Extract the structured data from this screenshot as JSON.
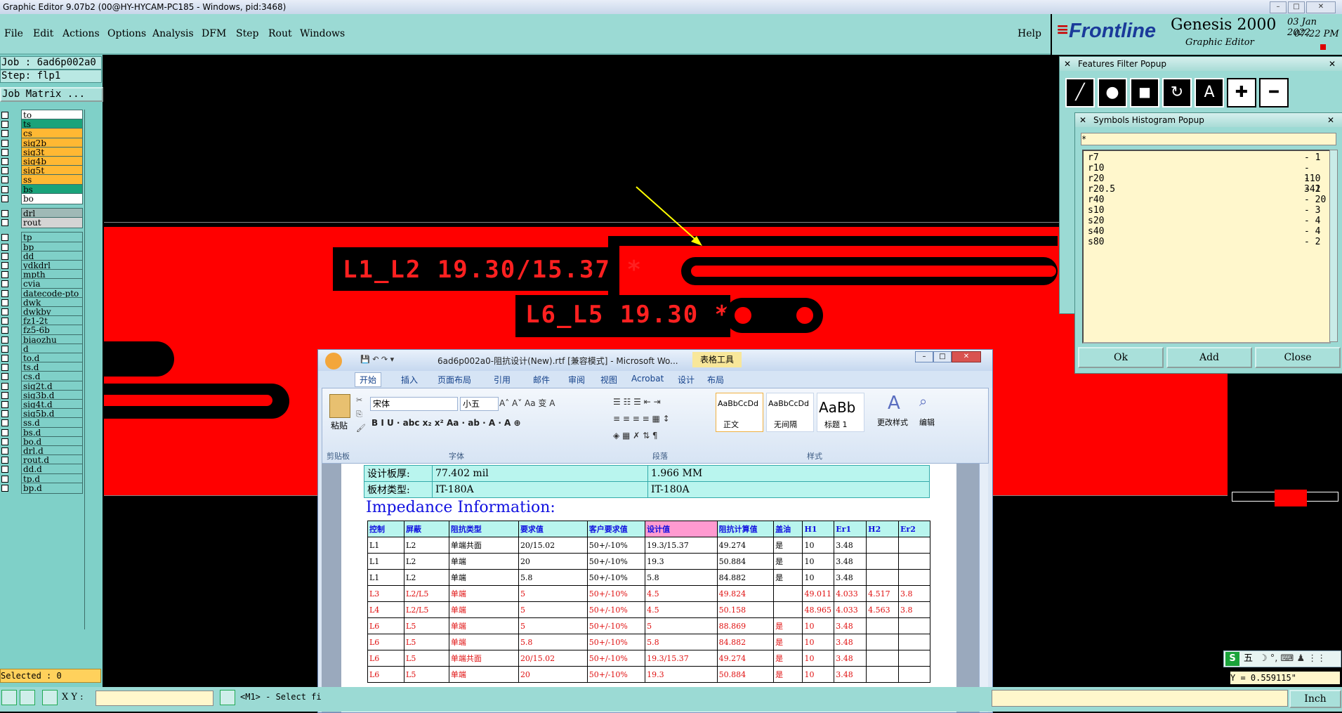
{
  "window": {
    "title": "Graphic Editor 9.07b2 (00@HY-HYCAM-PC185 - Windows, pid:3468)",
    "min": "–",
    "max": "□",
    "close": "✕"
  },
  "menu": {
    "file": "File",
    "edit": "Edit",
    "actions": "Actions",
    "options": "Options",
    "analysis": "Analysis",
    "dfm": "DFM",
    "step": "Step",
    "rout": "Rout",
    "windows": "Windows",
    "help": "Help"
  },
  "brand": {
    "logo": "Frontline",
    "product": "Genesis 2000",
    "subtitle": "Graphic Editor",
    "date": "03 Jan 2022",
    "time": "07:22 PM"
  },
  "left": {
    "job": "Job : 6ad6p002a0",
    "step": "Step: flp1",
    "matrix": "Job Matrix ...",
    "selected": "Selected : 0",
    "layers": [
      {
        "name": "to",
        "color": "#ffffff"
      },
      {
        "name": "ts",
        "color": "#1aa37a"
      },
      {
        "name": "cs",
        "color": "#ffb833"
      },
      {
        "name": "sig2b",
        "color": "#ffb833"
      },
      {
        "name": "sig3t",
        "color": "#ffb833"
      },
      {
        "name": "sig4b",
        "color": "#ffb833"
      },
      {
        "name": "sig5t",
        "color": "#ffb833"
      },
      {
        "name": "ss",
        "color": "#ffb833"
      },
      {
        "name": "bs",
        "color": "#1aa37a"
      },
      {
        "name": "bo",
        "color": "#ffffff"
      },
      {
        "name": "drl",
        "color": "#9fb9b6"
      },
      {
        "name": "rout",
        "color": "#d4d4d4"
      },
      {
        "name": "tp",
        "color": "#7fd0c8"
      },
      {
        "name": "bp",
        "color": "#7fd0c8"
      },
      {
        "name": "dd",
        "color": "#7fd0c8"
      },
      {
        "name": "ydkdrl",
        "color": "#7fd0c8"
      },
      {
        "name": "mpth",
        "color": "#7fd0c8"
      },
      {
        "name": "cvia",
        "color": "#7fd0c8"
      },
      {
        "name": "datecode-pto",
        "color": "#7fd0c8"
      },
      {
        "name": "dwk",
        "color": "#7fd0c8"
      },
      {
        "name": "dwkby",
        "color": "#7fd0c8"
      },
      {
        "name": "fz1-2t",
        "color": "#7fd0c8"
      },
      {
        "name": "fz5-6b",
        "color": "#7fd0c8"
      },
      {
        "name": "biaozhu",
        "color": "#7fd0c8"
      },
      {
        "name": "d",
        "color": "#7fd0c8"
      },
      {
        "name": "to.d",
        "color": "#7fd0c8"
      },
      {
        "name": "ts.d",
        "color": "#7fd0c8"
      },
      {
        "name": "cs.d",
        "color": "#7fd0c8"
      },
      {
        "name": "sig2t.d",
        "color": "#7fd0c8"
      },
      {
        "name": "sig3b.d",
        "color": "#7fd0c8"
      },
      {
        "name": "sig4t.d",
        "color": "#7fd0c8"
      },
      {
        "name": "sig5b.d",
        "color": "#7fd0c8"
      },
      {
        "name": "ss.d",
        "color": "#7fd0c8"
      },
      {
        "name": "bs.d",
        "color": "#7fd0c8"
      },
      {
        "name": "bo.d",
        "color": "#7fd0c8"
      },
      {
        "name": "drl.d",
        "color": "#7fd0c8"
      },
      {
        "name": "rout.d",
        "color": "#7fd0c8"
      },
      {
        "name": "dd.d",
        "color": "#7fd0c8"
      },
      {
        "name": "tp.d",
        "color": "#7fd0c8"
      },
      {
        "name": "bp.d",
        "color": "#7fd0c8"
      }
    ]
  },
  "canvas": {
    "text1": "L1_L2 19.30/15.37 *",
    "text2": "L6_L5 19.30 *"
  },
  "ffpopup": {
    "title": "Features Filter Popup"
  },
  "sympopup": {
    "title": "Symbols Histogram Popup",
    "filter": "*",
    "rows": [
      {
        "name": "r7",
        "count": "- 1"
      },
      {
        "name": "r10",
        "count": "- 110"
      },
      {
        "name": "r20",
        "count": "- 341"
      },
      {
        "name": "r20.5",
        "count": "- 2"
      },
      {
        "name": "r40",
        "count": "- 20"
      },
      {
        "name": "s10",
        "count": "- 3"
      },
      {
        "name": "s20",
        "count": "- 4"
      },
      {
        "name": "s40",
        "count": "- 4"
      },
      {
        "name": "s80",
        "count": "- 2"
      }
    ],
    "ok": "Ok",
    "add": "Add",
    "close": "Close"
  },
  "word": {
    "title": "6ad6p002a0-阻抗设计(New).rtf [兼容模式] - Microsoft Wo...",
    "tools": "表格工具",
    "tabs": [
      "开始",
      "插入",
      "页面布局",
      "引用",
      "邮件",
      "审阅",
      "视图",
      "Acrobat",
      "设计",
      "布局"
    ],
    "font": "宋体",
    "size": "小五",
    "groups": {
      "clipboard": "剪贴板",
      "font": "字体",
      "para": "段落",
      "styles": "样式"
    },
    "paste": "粘贴",
    "styles": [
      {
        "sample": "AaBbCcDd",
        "name": "正文"
      },
      {
        "sample": "AaBbCcDd",
        "name": "无间隔"
      },
      {
        "sample": "AaBb",
        "name": "标题 1"
      }
    ],
    "change_styles": "更改样式",
    "edit": "编辑",
    "board": {
      "row1": [
        "设计板厚:",
        "77.402 mil",
        "1.966 MM"
      ],
      "row2": [
        "板材类型:",
        "IT-180A",
        "IT-180A"
      ]
    },
    "heading": "Impedance Information:",
    "headers": [
      "控制",
      "屏蔽",
      "阻抗类型",
      "要求值",
      "客户要求值",
      "设计值",
      "阻抗计算值",
      "盖油",
      "H1",
      "Er1",
      "H2",
      "Er2"
    ],
    "rows": [
      [
        "L1",
        "L2",
        "单端共面",
        "20/15.02",
        "50+/-10%",
        "19.3/15.37",
        "49.274",
        "是",
        "10",
        "3.48",
        "",
        ""
      ],
      [
        "L1",
        "L2",
        "单端",
        "20",
        "50+/-10%",
        "19.3",
        "50.884",
        "是",
        "10",
        "3.48",
        "",
        ""
      ],
      [
        "L1",
        "L2",
        "单端",
        "5.8",
        "50+/-10%",
        "5.8",
        "84.882",
        "是",
        "10",
        "3.48",
        "",
        ""
      ],
      [
        "L3",
        "L2/L5",
        "单端",
        "5",
        "50+/-10%",
        "4.5",
        "49.824",
        "",
        "49.011",
        "4.033",
        "4.517",
        "3.8"
      ],
      [
        "L4",
        "L2/L5",
        "单端",
        "5",
        "50+/-10%",
        "4.5",
        "50.158",
        "",
        "48.965",
        "4.033",
        "4.563",
        "3.8"
      ],
      [
        "L6",
        "L5",
        "单端",
        "5",
        "50+/-10%",
        "5",
        "88.869",
        "是",
        "10",
        "3.48",
        "",
        ""
      ],
      [
        "L6",
        "L5",
        "单端",
        "5.8",
        "50+/-10%",
        "5.8",
        "84.882",
        "是",
        "10",
        "3.48",
        "",
        ""
      ],
      [
        "L6",
        "L5",
        "单端共面",
        "20/15.02",
        "50+/-10%",
        "19.3/15.37",
        "49.274",
        "是",
        "10",
        "3.48",
        "",
        ""
      ],
      [
        "L6",
        "L5",
        "单端",
        "20",
        "50+/-10%",
        "19.3",
        "50.884",
        "是",
        "10",
        "3.48",
        "",
        ""
      ]
    ],
    "red_rows_from": 3
  },
  "bottom": {
    "xy": "X Y :",
    "select": "<M1> - Select fi",
    "coord": "Y = 0.559115\"",
    "unit": "Inch",
    "ime": "五"
  }
}
